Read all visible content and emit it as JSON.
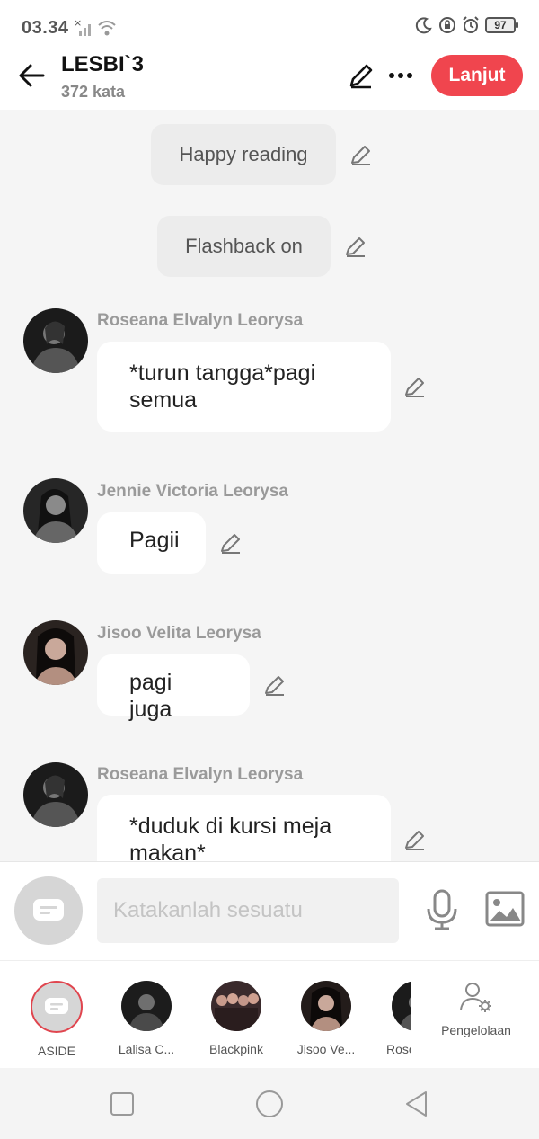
{
  "status_bar": {
    "time": "03.34",
    "battery": "97"
  },
  "header": {
    "title": "LESBI`3",
    "word_count": "372 kata",
    "continue_label": "Lanjut"
  },
  "narrations": [
    {
      "text": "Happy reading"
    },
    {
      "text": "Flashback on"
    }
  ],
  "messages": [
    {
      "speaker": "Roseana Elvalyn Leorysa",
      "text": "*turun tangga*pagi semua"
    },
    {
      "speaker": "Jennie Victoria Leorysa",
      "text": "Pagii"
    },
    {
      "speaker": "Jisoo Velita Leorysa",
      "text": "pagi juga"
    },
    {
      "speaker": "Roseana Elvalyn Leorysa",
      "text": "*duduk di kursi meja makan*"
    }
  ],
  "input": {
    "placeholder": "Katakanlah sesuatu"
  },
  "characters": [
    {
      "label": "ASIDE"
    },
    {
      "label": "Lalisa C..."
    },
    {
      "label": "Blackpink"
    },
    {
      "label": "Jisoo Ve..."
    },
    {
      "label": "Rosé"
    }
  ],
  "management": {
    "label": "Pengelolaan"
  },
  "colors": {
    "accent": "#f0454e",
    "bubble": "#ffffff",
    "narration": "#ececec",
    "background": "#f5f5f5"
  }
}
